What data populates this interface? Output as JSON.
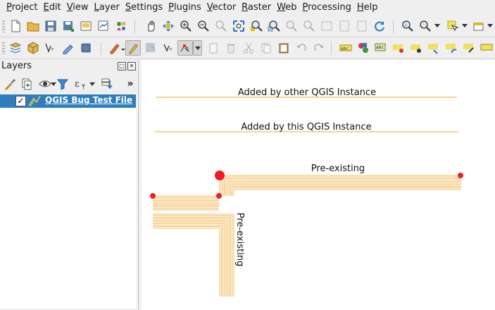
{
  "menubar": {
    "items": [
      "Project",
      "Edit",
      "View",
      "Layer",
      "Settings",
      "Plugins",
      "Vector",
      "Raster",
      "Web",
      "Processing",
      "Help"
    ]
  },
  "toolbar1": {
    "icons": [
      "new-project-icon",
      "open-project-icon",
      "save-project-icon",
      "save-as-icon",
      "new-print-layout-icon",
      "layout-manager-icon",
      "style-manager-icon",
      "pan-icon",
      "pan-to-selection-icon",
      "zoom-in-icon",
      "zoom-out-icon",
      "zoom-native-icon",
      "zoom-full-icon",
      "zoom-to-selection-icon",
      "zoom-to-layer-icon",
      "zoom-last-icon",
      "zoom-next-icon",
      "new-map-view-icon",
      "new-3d-view-icon",
      "temporal-icon",
      "refresh-icon",
      "identify-icon",
      "measure-icon",
      "select-icon",
      "attribute-table-icon"
    ]
  },
  "toolbar2": {
    "icons": [
      "data-source-manager-icon",
      "new-geopackage-layer-icon",
      "new-vector-layer-icon",
      "digitize-icon",
      "new-memory-layer-icon",
      "current-edits-icon",
      "toggle-editing-icon",
      "save-edits-icon",
      "add-feature-icon",
      "vertex-tool-icon",
      "delete-selected-icon",
      "cut-features-icon",
      "copy-features-icon",
      "paste-features-icon",
      "undo-icon",
      "redo-icon",
      "label-toolbar-icon",
      "diagram-icon",
      "highlight-pinned-icon",
      "pin-label-icon",
      "show-hide-label-icon",
      "move-label-icon",
      "rotate-label-icon",
      "change-label-icon"
    ]
  },
  "layers_panel": {
    "title": "Layers",
    "layers": [
      {
        "name": "QGIS Bug Test File",
        "checked": true,
        "selected": true
      }
    ]
  },
  "canvas": {
    "labels": {
      "other_instance": "Added by other QGIS Instance",
      "this_instance": "Added by this QGIS Instance",
      "pre_existing_h": "Pre-existing",
      "pre_existing_v": "Pre-existing"
    },
    "colors": {
      "line": "#f0a830",
      "vertex": "#ee1c24",
      "background": "#ffffff"
    }
  }
}
